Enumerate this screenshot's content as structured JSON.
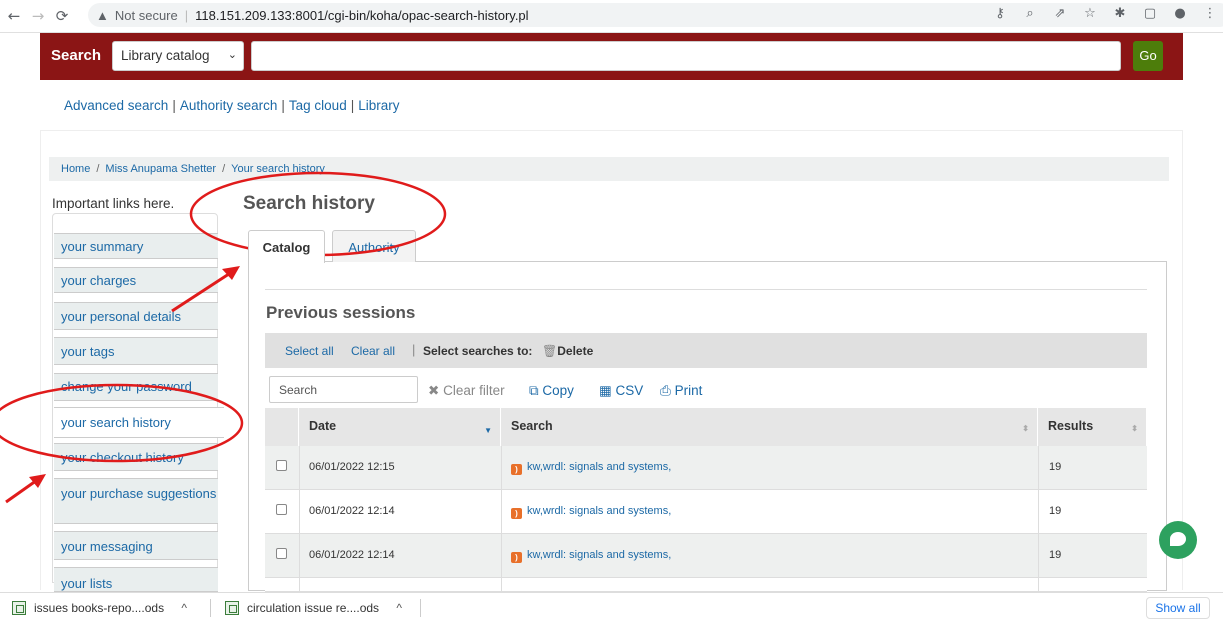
{
  "browser": {
    "security_label": "Not secure",
    "url": "118.151.209.133:8001/cgi-bin/koha/opac-search-history.pl"
  },
  "masthead": {
    "search_label": "Search",
    "catalog_select": "Library catalog",
    "go_label": "Go",
    "search_value": ""
  },
  "more_searches": [
    "Advanced search",
    "Authority search",
    "Tag cloud",
    "Library"
  ],
  "breadcrumb": [
    "Home",
    "Miss Anupama Shetter",
    "Your search history"
  ],
  "sidebar": {
    "intro": "Important links here.",
    "items": [
      {
        "label": "your summary"
      },
      {
        "label": "your charges"
      },
      {
        "label": "your personal details"
      },
      {
        "label": "your tags"
      },
      {
        "label": "change your password"
      },
      {
        "label": "your search history",
        "active": true
      },
      {
        "label": "your checkout history"
      },
      {
        "label": "your purchase suggestions"
      },
      {
        "label": "your messaging"
      },
      {
        "label": "your lists"
      }
    ]
  },
  "page_title": "Search history",
  "tabs": [
    {
      "label": "Catalog",
      "active": true
    },
    {
      "label": "Authority",
      "active": false
    }
  ],
  "section_title": "Previous sessions",
  "toolbar": {
    "select_all": "Select all",
    "clear_all": "Clear all",
    "select_searches": "Select searches to:",
    "delete": "Delete"
  },
  "table_controls": {
    "search_placeholder": "Search",
    "clear_filter": "Clear filter",
    "copy": "Copy",
    "csv": "CSV",
    "print": "Print"
  },
  "table": {
    "headers": [
      "Date",
      "Search",
      "Results"
    ],
    "rows": [
      {
        "date": "06/01/2022 12:15",
        "search": "kw,wrdl: signals and systems,",
        "results": "19"
      },
      {
        "date": "06/01/2022 12:14",
        "search": "kw,wrdl: signals and systems,",
        "results": "19"
      },
      {
        "date": "06/01/2022 12:14",
        "search": "kw,wrdl: signals and systems,",
        "results": "19"
      }
    ]
  },
  "downloads": [
    {
      "name": "issues books-repo....ods"
    },
    {
      "name": "circulation issue re....ods"
    }
  ],
  "downloads_show_all": "Show all",
  "colors": {
    "masthead": "#8b1515",
    "go_button": "#4d7d0b",
    "link": "#1c69a6",
    "annotation": "#e01b1b"
  }
}
